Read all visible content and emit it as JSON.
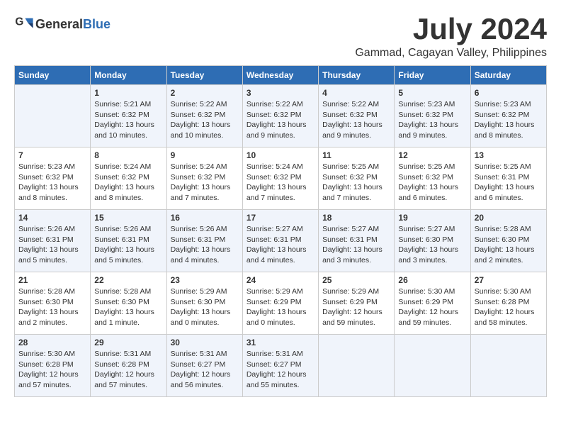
{
  "logo": {
    "general": "General",
    "blue": "Blue"
  },
  "title": "July 2024",
  "location": "Gammad, Cagayan Valley, Philippines",
  "days_of_week": [
    "Sunday",
    "Monday",
    "Tuesday",
    "Wednesday",
    "Thursday",
    "Friday",
    "Saturday"
  ],
  "weeks": [
    [
      {
        "day": "",
        "info": ""
      },
      {
        "day": "1",
        "info": "Sunrise: 5:21 AM\nSunset: 6:32 PM\nDaylight: 13 hours\nand 10 minutes."
      },
      {
        "day": "2",
        "info": "Sunrise: 5:22 AM\nSunset: 6:32 PM\nDaylight: 13 hours\nand 10 minutes."
      },
      {
        "day": "3",
        "info": "Sunrise: 5:22 AM\nSunset: 6:32 PM\nDaylight: 13 hours\nand 9 minutes."
      },
      {
        "day": "4",
        "info": "Sunrise: 5:22 AM\nSunset: 6:32 PM\nDaylight: 13 hours\nand 9 minutes."
      },
      {
        "day": "5",
        "info": "Sunrise: 5:23 AM\nSunset: 6:32 PM\nDaylight: 13 hours\nand 9 minutes."
      },
      {
        "day": "6",
        "info": "Sunrise: 5:23 AM\nSunset: 6:32 PM\nDaylight: 13 hours\nand 8 minutes."
      }
    ],
    [
      {
        "day": "7",
        "info": "Sunrise: 5:23 AM\nSunset: 6:32 PM\nDaylight: 13 hours\nand 8 minutes."
      },
      {
        "day": "8",
        "info": "Sunrise: 5:24 AM\nSunset: 6:32 PM\nDaylight: 13 hours\nand 8 minutes."
      },
      {
        "day": "9",
        "info": "Sunrise: 5:24 AM\nSunset: 6:32 PM\nDaylight: 13 hours\nand 7 minutes."
      },
      {
        "day": "10",
        "info": "Sunrise: 5:24 AM\nSunset: 6:32 PM\nDaylight: 13 hours\nand 7 minutes."
      },
      {
        "day": "11",
        "info": "Sunrise: 5:25 AM\nSunset: 6:32 PM\nDaylight: 13 hours\nand 7 minutes."
      },
      {
        "day": "12",
        "info": "Sunrise: 5:25 AM\nSunset: 6:32 PM\nDaylight: 13 hours\nand 6 minutes."
      },
      {
        "day": "13",
        "info": "Sunrise: 5:25 AM\nSunset: 6:31 PM\nDaylight: 13 hours\nand 6 minutes."
      }
    ],
    [
      {
        "day": "14",
        "info": "Sunrise: 5:26 AM\nSunset: 6:31 PM\nDaylight: 13 hours\nand 5 minutes."
      },
      {
        "day": "15",
        "info": "Sunrise: 5:26 AM\nSunset: 6:31 PM\nDaylight: 13 hours\nand 5 minutes."
      },
      {
        "day": "16",
        "info": "Sunrise: 5:26 AM\nSunset: 6:31 PM\nDaylight: 13 hours\nand 4 minutes."
      },
      {
        "day": "17",
        "info": "Sunrise: 5:27 AM\nSunset: 6:31 PM\nDaylight: 13 hours\nand 4 minutes."
      },
      {
        "day": "18",
        "info": "Sunrise: 5:27 AM\nSunset: 6:31 PM\nDaylight: 13 hours\nand 3 minutes."
      },
      {
        "day": "19",
        "info": "Sunrise: 5:27 AM\nSunset: 6:30 PM\nDaylight: 13 hours\nand 3 minutes."
      },
      {
        "day": "20",
        "info": "Sunrise: 5:28 AM\nSunset: 6:30 PM\nDaylight: 13 hours\nand 2 minutes."
      }
    ],
    [
      {
        "day": "21",
        "info": "Sunrise: 5:28 AM\nSunset: 6:30 PM\nDaylight: 13 hours\nand 2 minutes."
      },
      {
        "day": "22",
        "info": "Sunrise: 5:28 AM\nSunset: 6:30 PM\nDaylight: 13 hours\nand 1 minute."
      },
      {
        "day": "23",
        "info": "Sunrise: 5:29 AM\nSunset: 6:30 PM\nDaylight: 13 hours\nand 0 minutes."
      },
      {
        "day": "24",
        "info": "Sunrise: 5:29 AM\nSunset: 6:29 PM\nDaylight: 13 hours\nand 0 minutes."
      },
      {
        "day": "25",
        "info": "Sunrise: 5:29 AM\nSunset: 6:29 PM\nDaylight: 12 hours\nand 59 minutes."
      },
      {
        "day": "26",
        "info": "Sunrise: 5:30 AM\nSunset: 6:29 PM\nDaylight: 12 hours\nand 59 minutes."
      },
      {
        "day": "27",
        "info": "Sunrise: 5:30 AM\nSunset: 6:28 PM\nDaylight: 12 hours\nand 58 minutes."
      }
    ],
    [
      {
        "day": "28",
        "info": "Sunrise: 5:30 AM\nSunset: 6:28 PM\nDaylight: 12 hours\nand 57 minutes."
      },
      {
        "day": "29",
        "info": "Sunrise: 5:31 AM\nSunset: 6:28 PM\nDaylight: 12 hours\nand 57 minutes."
      },
      {
        "day": "30",
        "info": "Sunrise: 5:31 AM\nSunset: 6:27 PM\nDaylight: 12 hours\nand 56 minutes."
      },
      {
        "day": "31",
        "info": "Sunrise: 5:31 AM\nSunset: 6:27 PM\nDaylight: 12 hours\nand 55 minutes."
      },
      {
        "day": "",
        "info": ""
      },
      {
        "day": "",
        "info": ""
      },
      {
        "day": "",
        "info": ""
      }
    ]
  ]
}
